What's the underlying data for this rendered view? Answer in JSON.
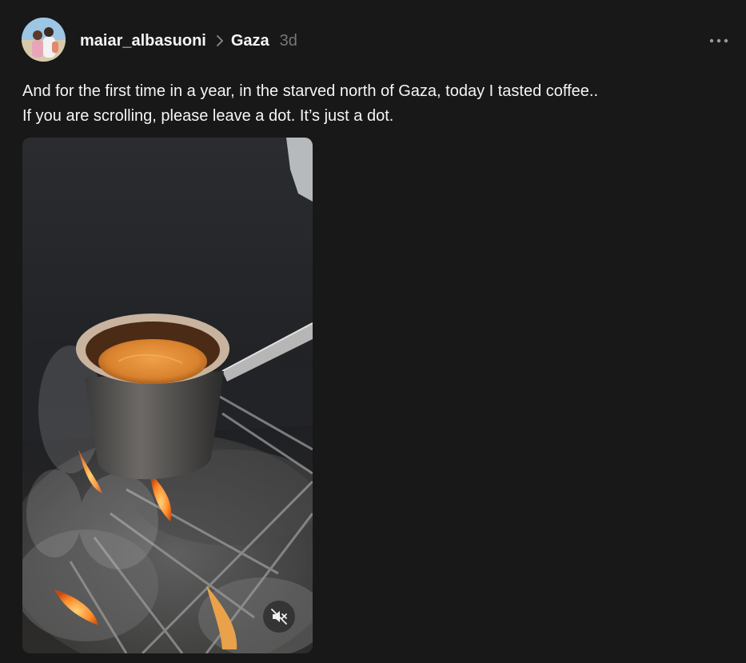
{
  "post": {
    "author": {
      "username": "maiar_albasuoni",
      "avatar_icon": "profile-photo"
    },
    "topic": "Gaza",
    "timestamp": "3d",
    "more_icon": "more-horizontal-icon",
    "caption_lines": [
      "And for the first time in a year, in the starved north of Gaza, today I tasted coffee..",
      "If you are scrolling, please leave a dot. It’s just a dot."
    ],
    "media": {
      "type": "video",
      "description_icon": "coffee-pot-over-fire",
      "muted_icon": "speaker-muted-icon"
    }
  },
  "colors": {
    "background": "#181818",
    "text_primary": "#f3f5f7",
    "text_secondary": "#777777"
  }
}
